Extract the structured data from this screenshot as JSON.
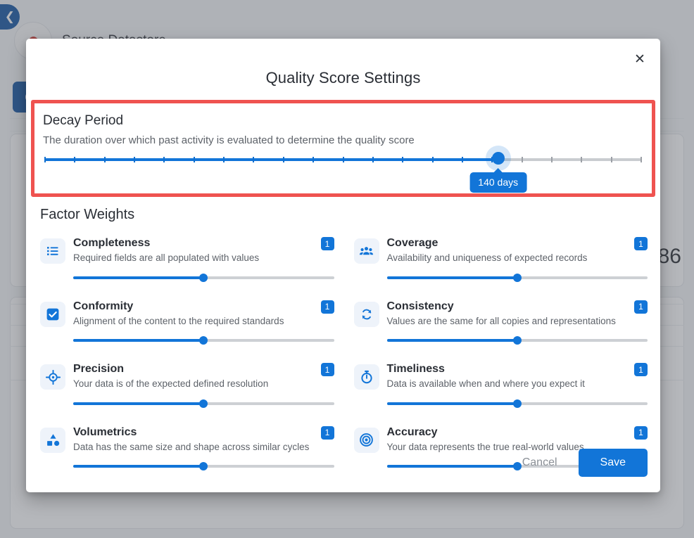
{
  "background": {
    "back_button_icon": "chevron-left-icon",
    "title": "Source Datastore",
    "score": "86"
  },
  "modal": {
    "title": "Quality Score Settings",
    "close_icon": "close-icon",
    "decay": {
      "heading": "Decay Period",
      "description": "The duration over which past activity is evaluated to determine the quality score",
      "tooltip_value": "140 days",
      "value": 140,
      "percent": 76,
      "tick_count": 20,
      "highlight_color": "#ef5350",
      "accent_color": "#1275d8"
    },
    "factors_heading": "Factor Weights",
    "factors": [
      {
        "name": "Completeness",
        "description": "Required fields are all populated with values",
        "weight": "1",
        "icon": "list-icon",
        "percent": 50
      },
      {
        "name": "Coverage",
        "description": "Availability and uniqueness of expected records",
        "weight": "1",
        "icon": "people-group-icon",
        "percent": 50
      },
      {
        "name": "Conformity",
        "description": "Alignment of the content to the required standards",
        "weight": "1",
        "icon": "checkbox-checked-icon",
        "percent": 50
      },
      {
        "name": "Consistency",
        "description": "Values are the same for all copies and representations",
        "weight": "1",
        "icon": "sync-refresh-icon",
        "percent": 50
      },
      {
        "name": "Precision",
        "description": "Your data is of the expected defined resolution",
        "weight": "1",
        "icon": "crosshair-target-icon",
        "percent": 50
      },
      {
        "name": "Timeliness",
        "description": "Data is available when and where you expect it",
        "weight": "1",
        "icon": "stopwatch-icon",
        "percent": 50
      },
      {
        "name": "Volumetrics",
        "description": "Data has the same size and shape across similar cycles",
        "weight": "1",
        "icon": "shapes-icon",
        "percent": 50
      },
      {
        "name": "Accuracy",
        "description": "Your data represents the true real-world values",
        "weight": "1",
        "icon": "bullseye-icon",
        "percent": 50
      }
    ],
    "footer": {
      "cancel_label": "Cancel",
      "save_label": "Save"
    }
  }
}
